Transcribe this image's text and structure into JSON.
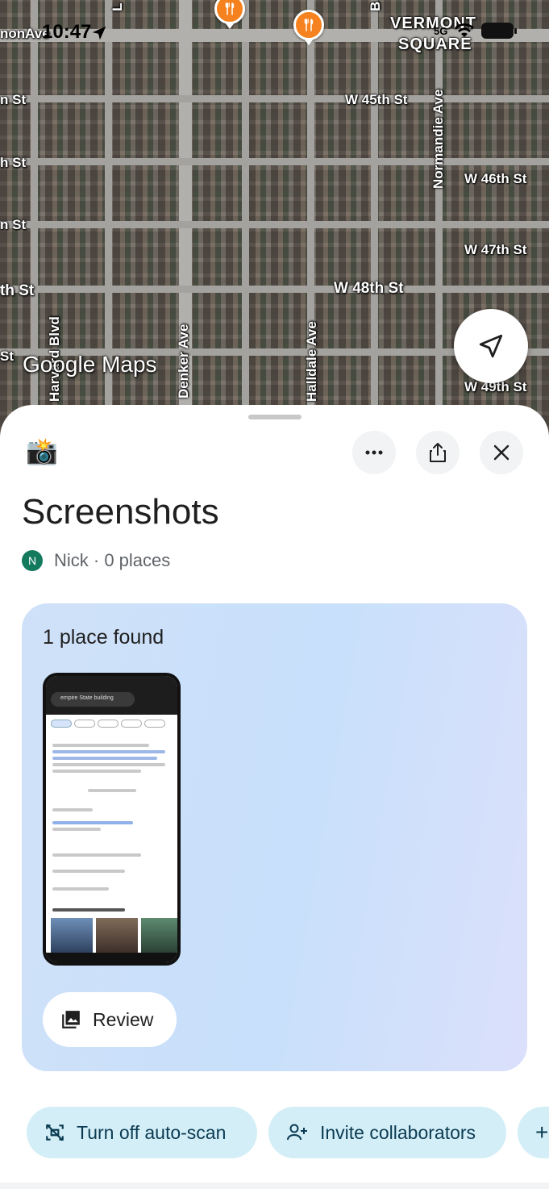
{
  "status_bar": {
    "time": "10:47",
    "signal_label": "5G"
  },
  "map": {
    "neighborhood": [
      "VERMONT",
      "SQUARE"
    ],
    "street_labels_h": [
      "nonAve",
      "W 45th St",
      "W 46th St",
      "W 47th St",
      "W 48th St",
      "W 49th St",
      "n St",
      "h St",
      "n St",
      "h St",
      "th St",
      "St"
    ],
    "street_labels_v": [
      "Normandie Ave",
      "Harvard Blvd",
      "Denker Ave",
      "Halldale Ave",
      "L",
      "B"
    ],
    "logo": "Google Maps",
    "poi_icons": [
      "restaurant-icon",
      "restaurant-icon"
    ],
    "locate_icon": "navigation-arrow-icon"
  },
  "sheet": {
    "list_emoji": "📸",
    "title": "Screenshots",
    "avatar_initial": "N",
    "owner_text": "Nick · 0 places",
    "found_card": {
      "title": "1 place found",
      "review_label": "Review",
      "thumbnail_search": "empire State building"
    },
    "chips": [
      {
        "label": "Turn off auto-scan",
        "icon": "scan-off-icon"
      },
      {
        "label": "Invite collaborators",
        "icon": "person-add-icon"
      },
      {
        "label": "+",
        "icon": "plus-icon"
      }
    ]
  },
  "colors": {
    "poi": "#f5821f",
    "avatar": "#137a5e",
    "chip_bg": "#d3eef7",
    "card_gradient_start": "#cfe1f8",
    "card_gradient_end": "#dbe0fb"
  }
}
